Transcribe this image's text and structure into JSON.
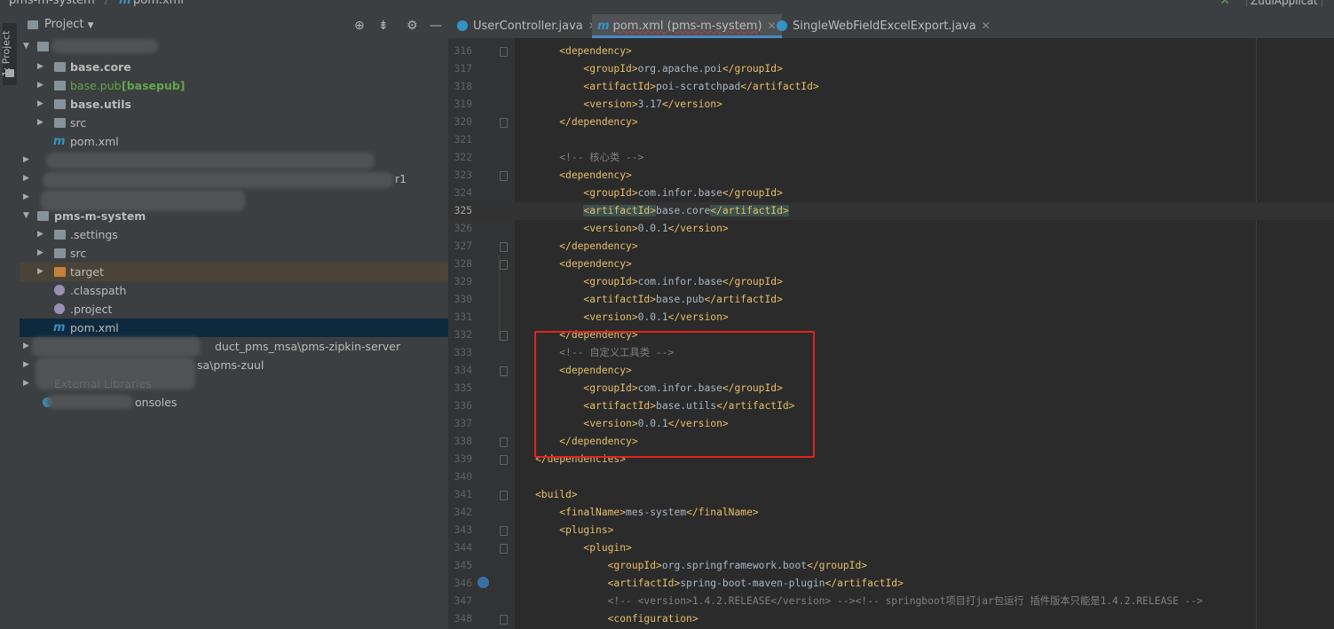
{
  "breadcrumb": {
    "project": "pms-m-system",
    "file": "pom.xml"
  },
  "top_right": {
    "run_config": "ZuulApplicat"
  },
  "tool_stripe": {
    "label": "1: Project"
  },
  "project_panel": {
    "title": "Project",
    "header_icons": [
      "target-icon",
      "collapse-icon",
      "gear-icon",
      "minimize-icon"
    ],
    "rows": [
      {
        "label": "base.core"
      },
      {
        "label": "base.pub",
        "tag": "[basepub]"
      },
      {
        "label": "base.utils"
      },
      {
        "label": "src"
      },
      {
        "label": "pom.xml"
      },
      {
        "label": "r1"
      },
      {
        "label": "pms-m-system"
      },
      {
        "label": ".settings"
      },
      {
        "label": "src"
      },
      {
        "label": "target"
      },
      {
        "label": ".classpath"
      },
      {
        "label": ".project"
      },
      {
        "label": "pom.xml"
      },
      {
        "label": "duct_pms_msa\\pms-zipkin-server"
      },
      {
        "label": "sa\\pms-zuul"
      },
      {
        "label": "External Libraries"
      },
      {
        "label": "onsoles"
      }
    ]
  },
  "tabs": [
    {
      "label": "UserController.java"
    },
    {
      "label": "pom.xml (pms-m-system)"
    },
    {
      "label": "SingleWebFieldExcelExport.java"
    }
  ],
  "editor": {
    "current_line": 325,
    "lines": [
      {
        "n": "316",
        "code": "    <dependency>"
      },
      {
        "n": "317",
        "code": "        <groupId>org.apache.poi</groupId>"
      },
      {
        "n": "318",
        "code": "        <artifactId>poi-scratchpad</artifactId>"
      },
      {
        "n": "319",
        "code": "        <version>3.17</version>"
      },
      {
        "n": "320",
        "code": "    </dependency>"
      },
      {
        "n": "321",
        "code": ""
      },
      {
        "n": "322",
        "code": "    <!-- 核心类 -->"
      },
      {
        "n": "323",
        "code": "    <dependency>"
      },
      {
        "n": "324",
        "code": "        <groupId>com.infor.base</groupId>"
      },
      {
        "n": "325",
        "code": "        <artifactId>base.core</artifactId>"
      },
      {
        "n": "326",
        "code": "        <version>0.0.1</version>"
      },
      {
        "n": "327",
        "code": "    </dependency>"
      },
      {
        "n": "328",
        "code": "    <dependency>"
      },
      {
        "n": "329",
        "code": "        <groupId>com.infor.base</groupId>"
      },
      {
        "n": "330",
        "code": "        <artifactId>base.pub</artifactId>"
      },
      {
        "n": "331",
        "code": "        <version>0.0.1</version>"
      },
      {
        "n": "332",
        "code": "    </dependency>"
      },
      {
        "n": "333",
        "code": "    <!-- 自定义工具类 -->"
      },
      {
        "n": "334",
        "code": "    <dependency>"
      },
      {
        "n": "335",
        "code": "        <groupId>com.infor.base</groupId>"
      },
      {
        "n": "336",
        "code": "        <artifactId>base.utils</artifactId>"
      },
      {
        "n": "337",
        "code": "        <version>0.0.1</version>"
      },
      {
        "n": "338",
        "code": "    </dependency>"
      },
      {
        "n": "339",
        "code": "</dependencies>"
      },
      {
        "n": "340",
        "code": ""
      },
      {
        "n": "341",
        "code": "<build>"
      },
      {
        "n": "342",
        "code": "    <finalName>mes-system</finalName>"
      },
      {
        "n": "343",
        "code": "    <plugins>"
      },
      {
        "n": "344",
        "code": "        <plugin>"
      },
      {
        "n": "345",
        "code": "            <groupId>org.springframework.boot</groupId>"
      },
      {
        "n": "346",
        "code": "            <artifactId>spring-boot-maven-plugin</artifactId>"
      },
      {
        "n": "347",
        "code": "            <!-- <version>1.4.2.RELEASE</version> --><!-- springboot项目打jar包运行 插件版本只能是1.4.2.RELEASE -->"
      },
      {
        "n": "348",
        "code": "            <configuration>"
      }
    ]
  },
  "colors": {
    "accent": "#4a88c7",
    "highlight_box": "#e0251c",
    "tag": "#e8bf6a",
    "comment": "#808080"
  }
}
